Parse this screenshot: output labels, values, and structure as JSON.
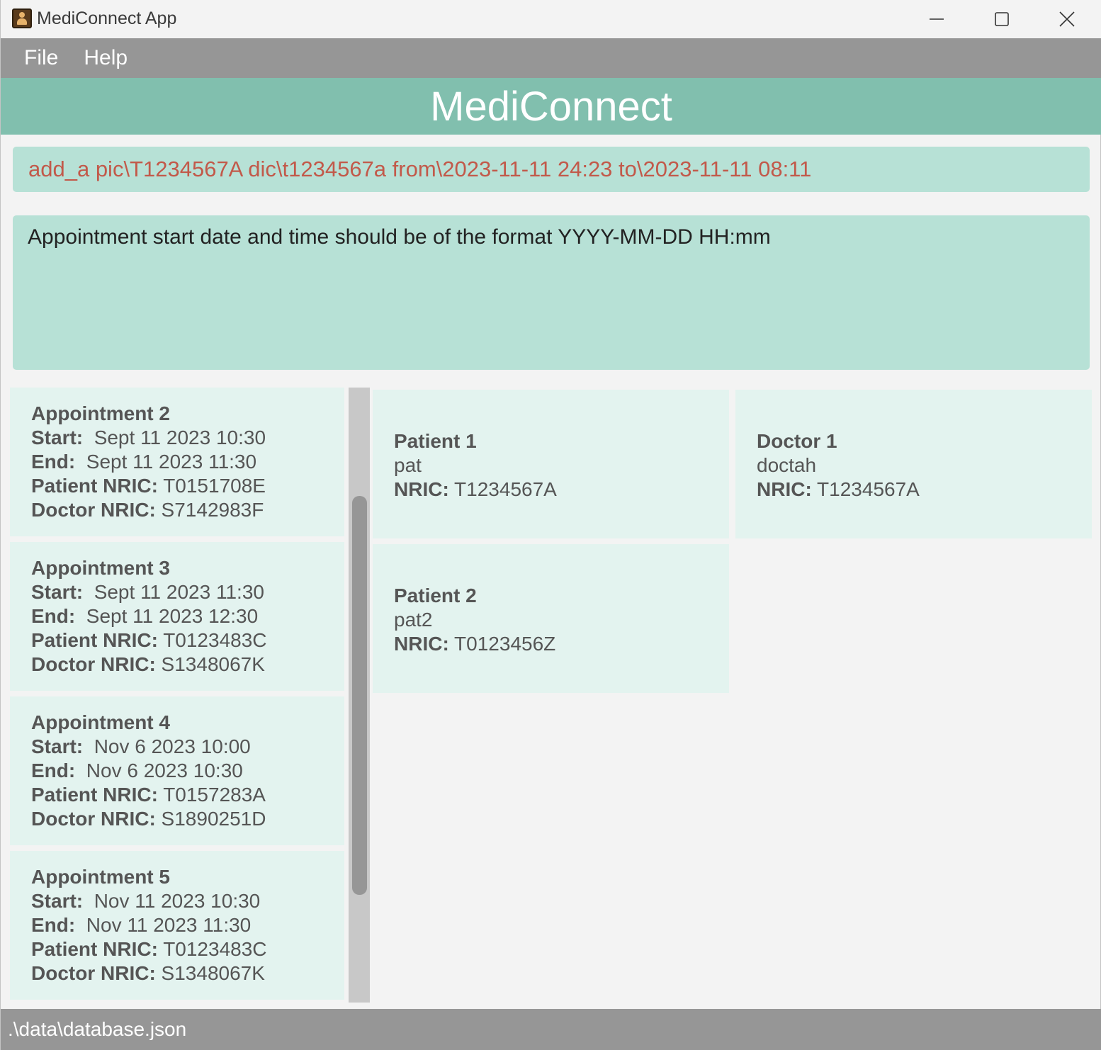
{
  "window": {
    "title": "MediConnect App",
    "icon": "address-book-icon"
  },
  "menu": {
    "items": [
      {
        "label": "File"
      },
      {
        "label": "Help"
      }
    ]
  },
  "banner": {
    "title": "MediConnect"
  },
  "command": {
    "value": "add_a pic\\T1234567A dic\\t1234567a from\\2023-11-11 24:23 to\\2023-11-11 08:11",
    "text_color": "#c2594a"
  },
  "result": {
    "message": "Appointment start date and time should be of the format YYYY-MM-DD HH:mm"
  },
  "labels": {
    "start": "Start:",
    "end": "End:",
    "patient_nric": "Patient NRIC:",
    "doctor_nric": "Doctor NRIC:",
    "nric": "NRIC:"
  },
  "appointments": [
    {
      "title": "Appointment 2",
      "start": "Sept 11 2023 10:30",
      "end": "Sept 11 2023 11:30",
      "patient_nric": "T0151708E",
      "doctor_nric": "S7142983F"
    },
    {
      "title": "Appointment 3",
      "start": "Sept 11 2023 11:30",
      "end": "Sept 11 2023 12:30",
      "patient_nric": "T0123483C",
      "doctor_nric": "S1348067K"
    },
    {
      "title": "Appointment 4",
      "start": "Nov 6 2023 10:00",
      "end": "Nov 6 2023 10:30",
      "patient_nric": "T0157283A",
      "doctor_nric": "S1890251D"
    },
    {
      "title": "Appointment 5",
      "start": "Nov 11 2023 10:30",
      "end": "Nov 11 2023 11:30",
      "patient_nric": "T0123483C",
      "doctor_nric": "S1348067K"
    }
  ],
  "patients": [
    {
      "title": "Patient 1",
      "name": "pat",
      "nric": "T1234567A"
    },
    {
      "title": "Patient 2",
      "name": "pat2",
      "nric": "T0123456Z"
    }
  ],
  "doctors": [
    {
      "title": "Doctor 1",
      "name": "doctah",
      "nric": "T1234567A"
    }
  ],
  "status": {
    "file_path": ".\\data\\database.json"
  },
  "colors": {
    "banner": "#81bfae",
    "command_box": "#b7e1d6",
    "card": "#e3f3ef",
    "menubar": "#969696"
  }
}
